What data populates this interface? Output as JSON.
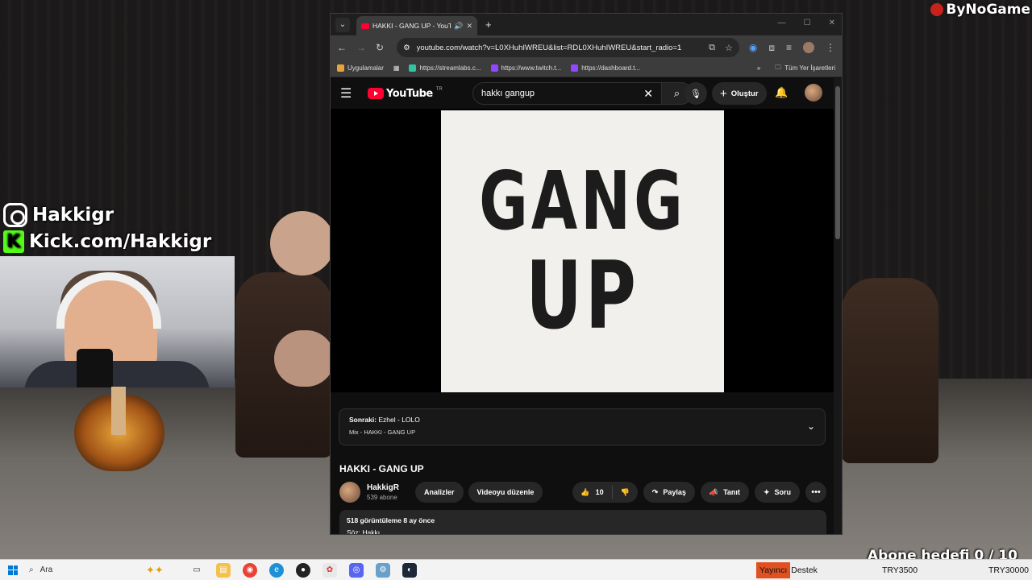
{
  "overlay": {
    "watermark": "ByNoGame",
    "instagram": "Hakkigr",
    "kick": "Kick.com/Hakkigr",
    "goal": "Abone hedefi 0 / 10"
  },
  "browser": {
    "tab_title": "HAKKI - GANG UP - YouTube",
    "url": "youtube.com/watch?v=L0XHuhIWREU&list=RDL0XHuhIWREU&start_radio=1",
    "bookmarks": [
      {
        "label": "Uygulamalar",
        "color": "#e8a33b"
      },
      {
        "label": "https://streamlabs.c...",
        "color": "#31c3a2"
      },
      {
        "label": "https://www.twitch.t...",
        "color": "#9146ff"
      },
      {
        "label": "https://dashboard.t...",
        "color": "#9146ff"
      }
    ],
    "all_bookmarks": "Tüm Yer İşaretleri"
  },
  "youtube": {
    "logo_text": "YouTube",
    "region": "TR",
    "search_query": "hakkı gangup",
    "create_label": "Oluştur",
    "cover_line1": "GANG",
    "cover_line2": "UP",
    "upnext_label": "Sonraki:",
    "upnext_title": "Ezhel - LOLO",
    "upnext_mix": "Mix - HAKKI - GANG UP",
    "video_title": "HAKKI - GANG UP",
    "channel_name": "HakkigR",
    "channel_subs": "539 abone",
    "analytics_label": "Analizler",
    "edit_label": "Videoyu düzenle",
    "like_count": "10",
    "share_label": "Paylaş",
    "promote_label": "Tanıt",
    "ask_label": "Soru",
    "stats": "518 görüntüleme  8 ay önce",
    "desc_line": "Söz: Hakkı"
  },
  "taskbar": {
    "search_label": "Ara",
    "yayinci": "Yayıncı",
    "destek": "Destek",
    "amount1": "TRY3500",
    "amount2": "TRY30000"
  }
}
